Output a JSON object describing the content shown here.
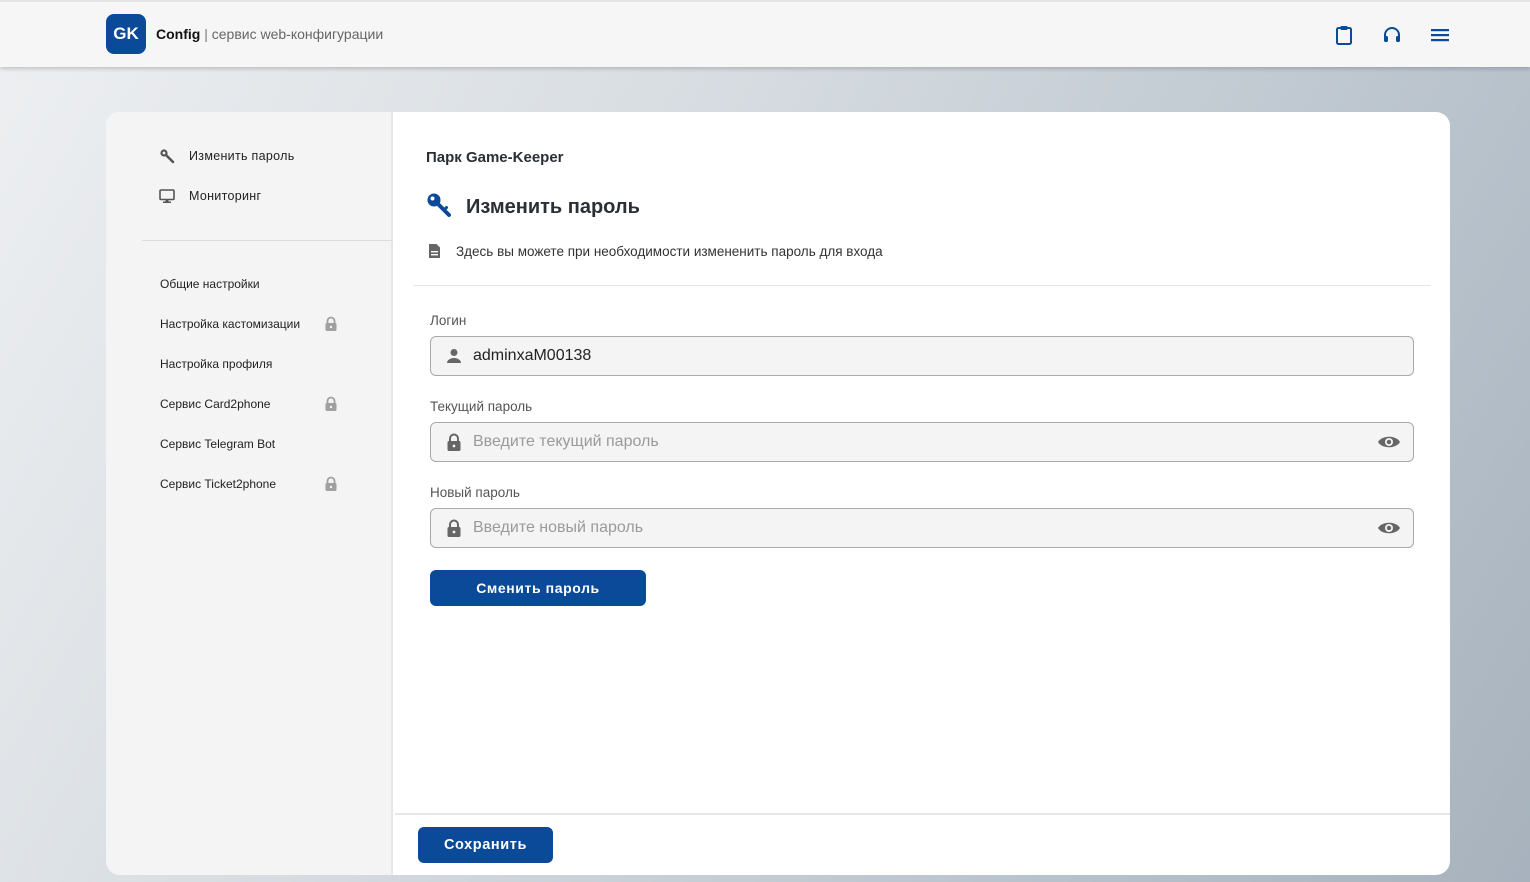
{
  "header": {
    "logo_text": "GK",
    "app_name": "Config",
    "separator": "|",
    "app_subtitle": "сервис web-конфигурации",
    "icons": [
      "clipboard-icon",
      "headset-icon",
      "menu-icon"
    ]
  },
  "sidebar": {
    "top_items": [
      {
        "label": "Изменить пароль",
        "icon": "wrench-icon"
      },
      {
        "label": "Мониторинг",
        "icon": "monitor-icon"
      }
    ],
    "items": [
      {
        "label": "Общие настройки",
        "locked": false
      },
      {
        "label": "Настройка кастомизации",
        "locked": true
      },
      {
        "label": "Настройка профиля",
        "locked": false
      },
      {
        "label": "Сервис Card2phone",
        "locked": true
      },
      {
        "label": "Сервис Telegram Bot",
        "locked": false
      },
      {
        "label": "Сервис Ticket2phone",
        "locked": true
      }
    ]
  },
  "main": {
    "park_title": "Парк Game-Keeper",
    "page_title": "Изменить пароль",
    "description": "Здесь вы можете при необходимости измененить пароль для входа",
    "login": {
      "label": "Логин",
      "value": "adminxaM00138"
    },
    "current_password": {
      "label": "Текущий пароль",
      "placeholder": "Введите текущий пароль"
    },
    "new_password": {
      "label": "Новый пароль",
      "placeholder": "Введите новый пароль"
    },
    "change_button": "Сменить пароль",
    "save_button": "Сохранить"
  },
  "colors": {
    "accent": "#0a4a99",
    "icon_gray": "#666666",
    "lock_gray": "#a0a0a0"
  }
}
